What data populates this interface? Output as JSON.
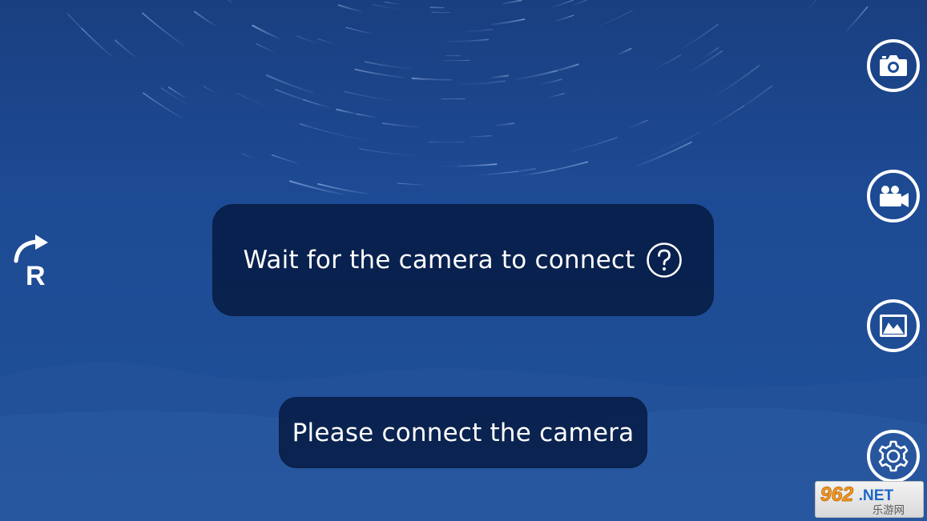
{
  "dialog": {
    "status_text": "Wait for the camera to connect",
    "notice_text": "Please connect the camera"
  },
  "icons": {
    "rotate": "rotate-r-icon",
    "help": "help-circle-icon",
    "photo": "camera-icon",
    "video": "video-camera-icon",
    "gallery": "gallery-icon",
    "settings": "gear-icon"
  },
  "watermark": {
    "primary": "962.NET",
    "secondary": "乐游网"
  },
  "colors": {
    "background": "#1e4d96",
    "message_bg": "#05183e",
    "icon_stroke": "#ffffff"
  }
}
